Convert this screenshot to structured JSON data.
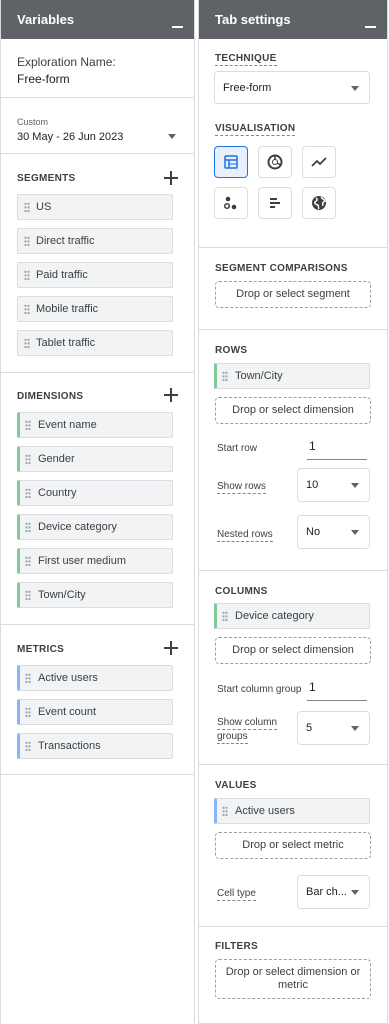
{
  "variables": {
    "title": "Variables",
    "exploration_label": "Exploration Name:",
    "exploration_name": "Free-form",
    "date_badge": "Custom",
    "date_range": "30 May - 26 Jun 2023",
    "segments": {
      "title": "SEGMENTS",
      "items": [
        "US",
        "Direct traffic",
        "Paid traffic",
        "Mobile traffic",
        "Tablet traffic"
      ]
    },
    "dimensions": {
      "title": "DIMENSIONS",
      "items": [
        "Event name",
        "Gender",
        "Country",
        "Device category",
        "First user medium",
        "Town/City"
      ]
    },
    "metrics": {
      "title": "METRICS",
      "items": [
        "Active users",
        "Event count",
        "Transactions"
      ]
    }
  },
  "tab_settings": {
    "title": "Tab settings",
    "technique": {
      "title": "TECHNIQUE",
      "value": "Free-form"
    },
    "visualisation": {
      "title": "VISUALISATION",
      "icons": [
        "table-icon",
        "donut-chart-icon",
        "line-chart-icon",
        "scatter-chart-icon",
        "bar-chart-icon",
        "geo-map-icon"
      ],
      "selected": "table-icon"
    },
    "segment_comparisons": {
      "title": "SEGMENT COMPARISONS",
      "drop": "Drop or select segment"
    },
    "rows": {
      "title": "ROWS",
      "chip": "Town/City",
      "drop": "Drop or select dimension",
      "start_label": "Start row",
      "start_value": "1",
      "show_label": "Show rows",
      "show_value": "10",
      "nested_label": "Nested rows",
      "nested_value": "No"
    },
    "columns": {
      "title": "COLUMNS",
      "chip": "Device category",
      "drop": "Drop or select dimension",
      "start_label": "Start column group",
      "start_value": "1",
      "show_label_1": "Show column",
      "show_label_2": "groups",
      "show_value": "5"
    },
    "values": {
      "title": "VALUES",
      "chip": "Active users",
      "drop": "Drop or select metric",
      "cell_label": "Cell type",
      "cell_value": "Bar ch..."
    },
    "filters": {
      "title": "FILTERS",
      "drop": "Drop or select dimension or metric"
    }
  },
  "colors": {
    "header": "#5f6368",
    "dimension_accent": "#81c995",
    "metric_accent": "#8ab4f8",
    "active_viz": "#1a73e8"
  }
}
